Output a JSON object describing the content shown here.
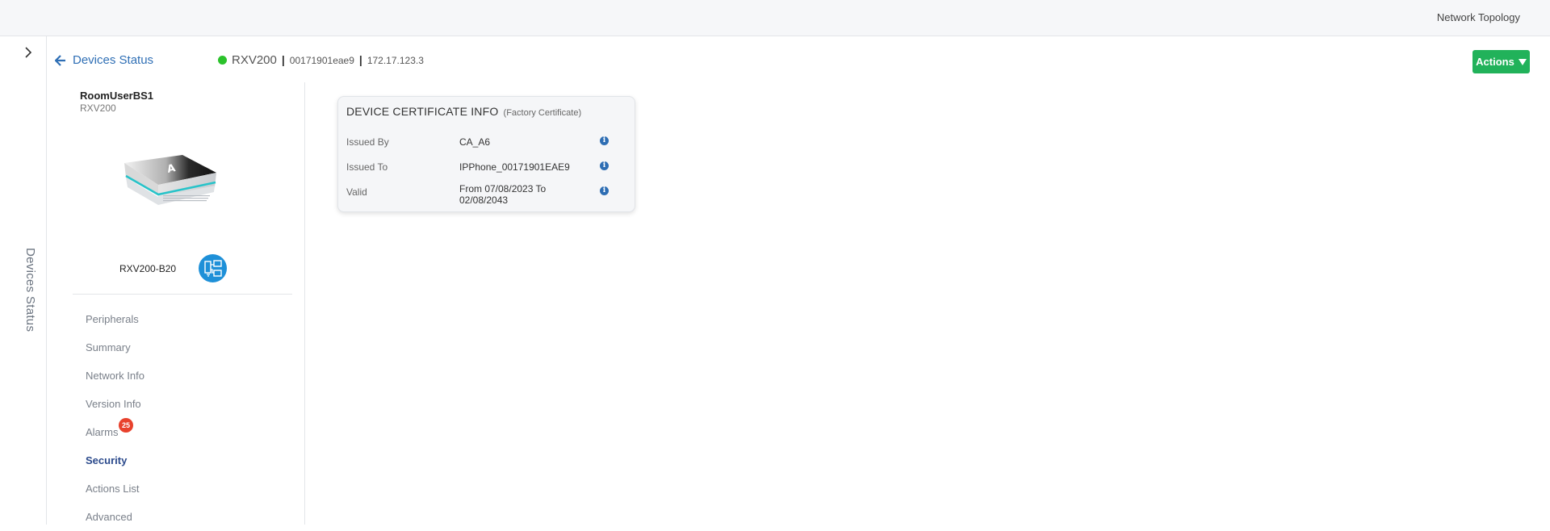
{
  "topbar": {
    "nav_link": "Network Topology"
  },
  "rail": {
    "vertical_label": "Devices Status"
  },
  "back_link": {
    "label": "Devices Status"
  },
  "device_header": {
    "status_color": "#2bc22b",
    "name": "RXV200",
    "separator": "|",
    "mac": "00171901eae9",
    "ip": "172.17.123.3"
  },
  "actions_button": {
    "label": "Actions",
    "color": "#21b25a"
  },
  "sidebar": {
    "room_name": "RoomUserBS1",
    "room_model": "RXV200",
    "model_code": "RXV200-B20",
    "menu": [
      {
        "label": "Peripherals"
      },
      {
        "label": "Summary"
      },
      {
        "label": "Network Info"
      },
      {
        "label": "Version Info"
      },
      {
        "label": "Alarms",
        "badge": "25"
      },
      {
        "label": "Security",
        "active": true
      },
      {
        "label": "Actions List"
      },
      {
        "label": "Advanced"
      }
    ]
  },
  "certificate": {
    "title": "DEVICE CERTIFICATE INFO",
    "subtitle": "(Factory Certificate)",
    "rows": [
      {
        "label": "Issued By",
        "value": "CA_A6"
      },
      {
        "label": "Issued To",
        "value": "IPPhone_00171901EAE9"
      },
      {
        "label": "Valid",
        "value": "From 07/08/2023 To 02/08/2043"
      }
    ],
    "info_icon_glyph": "i"
  }
}
